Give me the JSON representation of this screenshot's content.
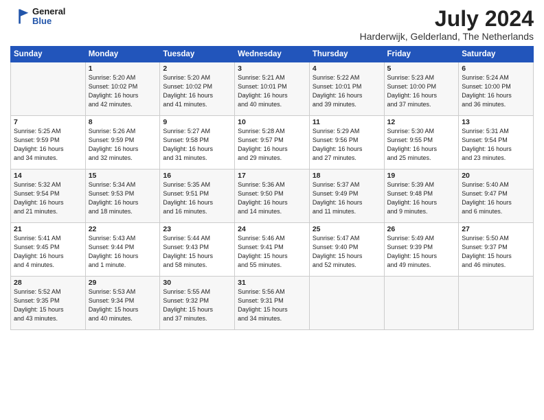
{
  "logo": {
    "line1": "General",
    "line2": "Blue"
  },
  "title": "July 2024",
  "location": "Harderwijk, Gelderland, The Netherlands",
  "headers": [
    "Sunday",
    "Monday",
    "Tuesday",
    "Wednesday",
    "Thursday",
    "Friday",
    "Saturday"
  ],
  "weeks": [
    [
      {
        "day": "",
        "info": ""
      },
      {
        "day": "1",
        "info": "Sunrise: 5:20 AM\nSunset: 10:02 PM\nDaylight: 16 hours\nand 42 minutes."
      },
      {
        "day": "2",
        "info": "Sunrise: 5:20 AM\nSunset: 10:02 PM\nDaylight: 16 hours\nand 41 minutes."
      },
      {
        "day": "3",
        "info": "Sunrise: 5:21 AM\nSunset: 10:01 PM\nDaylight: 16 hours\nand 40 minutes."
      },
      {
        "day": "4",
        "info": "Sunrise: 5:22 AM\nSunset: 10:01 PM\nDaylight: 16 hours\nand 39 minutes."
      },
      {
        "day": "5",
        "info": "Sunrise: 5:23 AM\nSunset: 10:00 PM\nDaylight: 16 hours\nand 37 minutes."
      },
      {
        "day": "6",
        "info": "Sunrise: 5:24 AM\nSunset: 10:00 PM\nDaylight: 16 hours\nand 36 minutes."
      }
    ],
    [
      {
        "day": "7",
        "info": "Sunrise: 5:25 AM\nSunset: 9:59 PM\nDaylight: 16 hours\nand 34 minutes."
      },
      {
        "day": "8",
        "info": "Sunrise: 5:26 AM\nSunset: 9:59 PM\nDaylight: 16 hours\nand 32 minutes."
      },
      {
        "day": "9",
        "info": "Sunrise: 5:27 AM\nSunset: 9:58 PM\nDaylight: 16 hours\nand 31 minutes."
      },
      {
        "day": "10",
        "info": "Sunrise: 5:28 AM\nSunset: 9:57 PM\nDaylight: 16 hours\nand 29 minutes."
      },
      {
        "day": "11",
        "info": "Sunrise: 5:29 AM\nSunset: 9:56 PM\nDaylight: 16 hours\nand 27 minutes."
      },
      {
        "day": "12",
        "info": "Sunrise: 5:30 AM\nSunset: 9:55 PM\nDaylight: 16 hours\nand 25 minutes."
      },
      {
        "day": "13",
        "info": "Sunrise: 5:31 AM\nSunset: 9:54 PM\nDaylight: 16 hours\nand 23 minutes."
      }
    ],
    [
      {
        "day": "14",
        "info": "Sunrise: 5:32 AM\nSunset: 9:54 PM\nDaylight: 16 hours\nand 21 minutes."
      },
      {
        "day": "15",
        "info": "Sunrise: 5:34 AM\nSunset: 9:53 PM\nDaylight: 16 hours\nand 18 minutes."
      },
      {
        "day": "16",
        "info": "Sunrise: 5:35 AM\nSunset: 9:51 PM\nDaylight: 16 hours\nand 16 minutes."
      },
      {
        "day": "17",
        "info": "Sunrise: 5:36 AM\nSunset: 9:50 PM\nDaylight: 16 hours\nand 14 minutes."
      },
      {
        "day": "18",
        "info": "Sunrise: 5:37 AM\nSunset: 9:49 PM\nDaylight: 16 hours\nand 11 minutes."
      },
      {
        "day": "19",
        "info": "Sunrise: 5:39 AM\nSunset: 9:48 PM\nDaylight: 16 hours\nand 9 minutes."
      },
      {
        "day": "20",
        "info": "Sunrise: 5:40 AM\nSunset: 9:47 PM\nDaylight: 16 hours\nand 6 minutes."
      }
    ],
    [
      {
        "day": "21",
        "info": "Sunrise: 5:41 AM\nSunset: 9:45 PM\nDaylight: 16 hours\nand 4 minutes."
      },
      {
        "day": "22",
        "info": "Sunrise: 5:43 AM\nSunset: 9:44 PM\nDaylight: 16 hours\nand 1 minute."
      },
      {
        "day": "23",
        "info": "Sunrise: 5:44 AM\nSunset: 9:43 PM\nDaylight: 15 hours\nand 58 minutes."
      },
      {
        "day": "24",
        "info": "Sunrise: 5:46 AM\nSunset: 9:41 PM\nDaylight: 15 hours\nand 55 minutes."
      },
      {
        "day": "25",
        "info": "Sunrise: 5:47 AM\nSunset: 9:40 PM\nDaylight: 15 hours\nand 52 minutes."
      },
      {
        "day": "26",
        "info": "Sunrise: 5:49 AM\nSunset: 9:39 PM\nDaylight: 15 hours\nand 49 minutes."
      },
      {
        "day": "27",
        "info": "Sunrise: 5:50 AM\nSunset: 9:37 PM\nDaylight: 15 hours\nand 46 minutes."
      }
    ],
    [
      {
        "day": "28",
        "info": "Sunrise: 5:52 AM\nSunset: 9:35 PM\nDaylight: 15 hours\nand 43 minutes."
      },
      {
        "day": "29",
        "info": "Sunrise: 5:53 AM\nSunset: 9:34 PM\nDaylight: 15 hours\nand 40 minutes."
      },
      {
        "day": "30",
        "info": "Sunrise: 5:55 AM\nSunset: 9:32 PM\nDaylight: 15 hours\nand 37 minutes."
      },
      {
        "day": "31",
        "info": "Sunrise: 5:56 AM\nSunset: 9:31 PM\nDaylight: 15 hours\nand 34 minutes."
      },
      {
        "day": "",
        "info": ""
      },
      {
        "day": "",
        "info": ""
      },
      {
        "day": "",
        "info": ""
      }
    ]
  ]
}
